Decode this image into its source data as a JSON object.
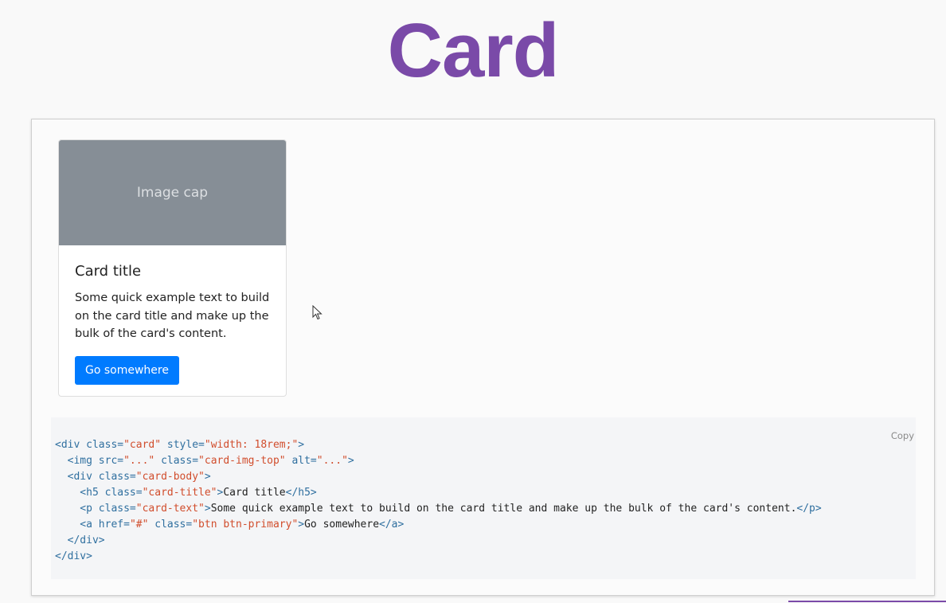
{
  "page": {
    "title": "Card",
    "title_color": "#7a4aa8"
  },
  "card": {
    "image_cap": "Image cap",
    "title": "Card title",
    "text": "Some quick example text to build on the card title and make up the bulk of the card's content.",
    "button_label": "Go somewhere",
    "button_color": "#007bff"
  },
  "code": {
    "copy_label": "Copy",
    "line1": {
      "open": "<div",
      "attr1": " class=",
      "val1": "\"card\"",
      "attr2": " style=",
      "val2": "\"width: 18rem;\"",
      "close": ">"
    },
    "line2": {
      "open": "  <img",
      "attr1": " src=",
      "val1": "\"...\"",
      "attr2": " class=",
      "val2": "\"card-img-top\"",
      "attr3": " alt=",
      "val3": "\"...\"",
      "close": ">"
    },
    "line3": {
      "open": "  <div",
      "attr1": " class=",
      "val1": "\"card-body\"",
      "close": ">"
    },
    "line4": {
      "open": "    <h5",
      "attr1": " class=",
      "val1": "\"card-title\"",
      "close": ">",
      "text": "Card title",
      "end": "</h5>"
    },
    "line5": {
      "open": "    <p",
      "attr1": " class=",
      "val1": "\"card-text\"",
      "close": ">",
      "text": "Some quick example text to build on the card title and make up the bulk of the card's content.",
      "end": "</p>"
    },
    "line6": {
      "open": "    <a",
      "attr1": " href=",
      "val1": "\"#\"",
      "attr2": " class=",
      "val2": "\"btn btn-primary\"",
      "close": ">",
      "text": "Go somewhere",
      "end": "</a>"
    },
    "line7": {
      "end": "  </div>"
    },
    "line8": {
      "end": "</div>"
    }
  }
}
